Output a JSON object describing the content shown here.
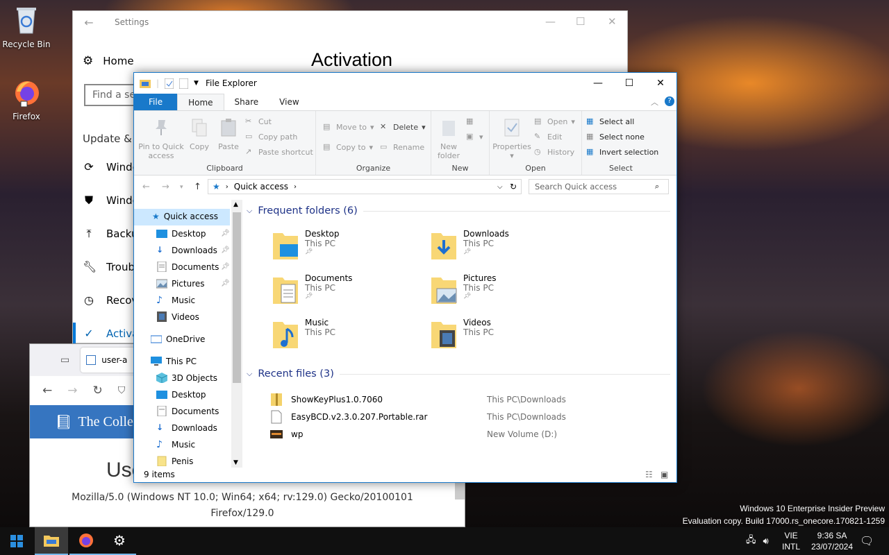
{
  "desktop": {
    "icons": [
      {
        "label": "Recycle Bin",
        "icon": "recycle-bin-icon"
      },
      {
        "label": "Firefox",
        "icon": "firefox-icon"
      }
    ],
    "watermark": {
      "line1": "Windows 10 Enterprise Insider Preview",
      "line2": "Evaluation copy. Build 17000.rs_onecore.170821-1259"
    }
  },
  "settings": {
    "window_title": "Settings",
    "home_label": "Home",
    "search_placeholder": "Find a set",
    "page_title": "Activation",
    "section_label": "Update & S",
    "items": [
      {
        "label": "Windo",
        "icon": "refresh-icon"
      },
      {
        "label": "Windo",
        "icon": "shield-icon"
      },
      {
        "label": "Backup",
        "icon": "backup-arrow-icon"
      },
      {
        "label": "Troubl",
        "icon": "wrench-icon"
      },
      {
        "label": "Recove",
        "icon": "history-icon"
      },
      {
        "label": "Activa",
        "icon": "check-circle-icon"
      }
    ]
  },
  "firefox": {
    "tab_label": "user-a",
    "banner_text": "The Colle",
    "heading": "Use",
    "ua_line1": "Mozilla/5.0 (Windows NT 10.0; Win64; x64; rv:129.0) Gecko/20100101",
    "ua_line2": "Firefox/129.0"
  },
  "explorer": {
    "title": "File Explorer",
    "tabs": {
      "file": "File",
      "home": "Home",
      "share": "Share",
      "view": "View"
    },
    "ribbon": {
      "clipboard": {
        "label": "Clipboard",
        "pin": "Pin to Quick",
        "pin2": "access",
        "copy": "Copy",
        "paste": "Paste",
        "cut": "Cut",
        "copy_path": "Copy path",
        "paste_shortcut": "Paste shortcut"
      },
      "organize": {
        "label": "Organize",
        "move_to": "Move to",
        "copy_to": "Copy to",
        "delete": "Delete",
        "rename": "Rename"
      },
      "new": {
        "label": "New",
        "new_folder": "New",
        "new_folder2": "folder"
      },
      "open": {
        "label": "Open",
        "properties": "Properties",
        "open": "Open",
        "edit": "Edit",
        "history": "History"
      },
      "select": {
        "label": "Select",
        "select_all": "Select all",
        "select_none": "Select none",
        "invert": "Invert selection"
      }
    },
    "address": "Quick access",
    "search_placeholder": "Search Quick access",
    "nav": [
      {
        "label": "Quick access"
      },
      {
        "label": "Desktop"
      },
      {
        "label": "Downloads"
      },
      {
        "label": "Documents"
      },
      {
        "label": "Pictures"
      },
      {
        "label": "Music"
      },
      {
        "label": "Videos"
      },
      {
        "label": "OneDrive"
      },
      {
        "label": "This PC"
      },
      {
        "label": "3D Objects"
      },
      {
        "label": "Desktop"
      },
      {
        "label": "Documents"
      },
      {
        "label": "Downloads"
      },
      {
        "label": "Music"
      },
      {
        "label": "Penis"
      }
    ],
    "frequent_header": "Frequent folders (6)",
    "folders": [
      {
        "name": "Desktop",
        "location": "This PC"
      },
      {
        "name": "Downloads",
        "location": "This PC"
      },
      {
        "name": "Documents",
        "location": "This PC"
      },
      {
        "name": "Pictures",
        "location": "This PC"
      },
      {
        "name": "Music",
        "location": "This PC"
      },
      {
        "name": "Videos",
        "location": "This PC"
      }
    ],
    "recent_header": "Recent files (3)",
    "recent": [
      {
        "name": "ShowKeyPlus1.0.7060",
        "location": "This PC\\Downloads"
      },
      {
        "name": "EasyBCD.v2.3.0.207.Portable.rar",
        "location": "This PC\\Downloads"
      },
      {
        "name": "wp",
        "location": "New Volume (D:)"
      }
    ],
    "status": "9 items"
  },
  "taskbar": {
    "lang1": "VIE",
    "lang2": "INTL",
    "time": "9:36 SA",
    "date": "23/07/2024"
  },
  "colors": {
    "accent": "#1979ca",
    "selection": "#cce8ff",
    "group_header": "#1e3287",
    "taskbar": "#101010"
  }
}
